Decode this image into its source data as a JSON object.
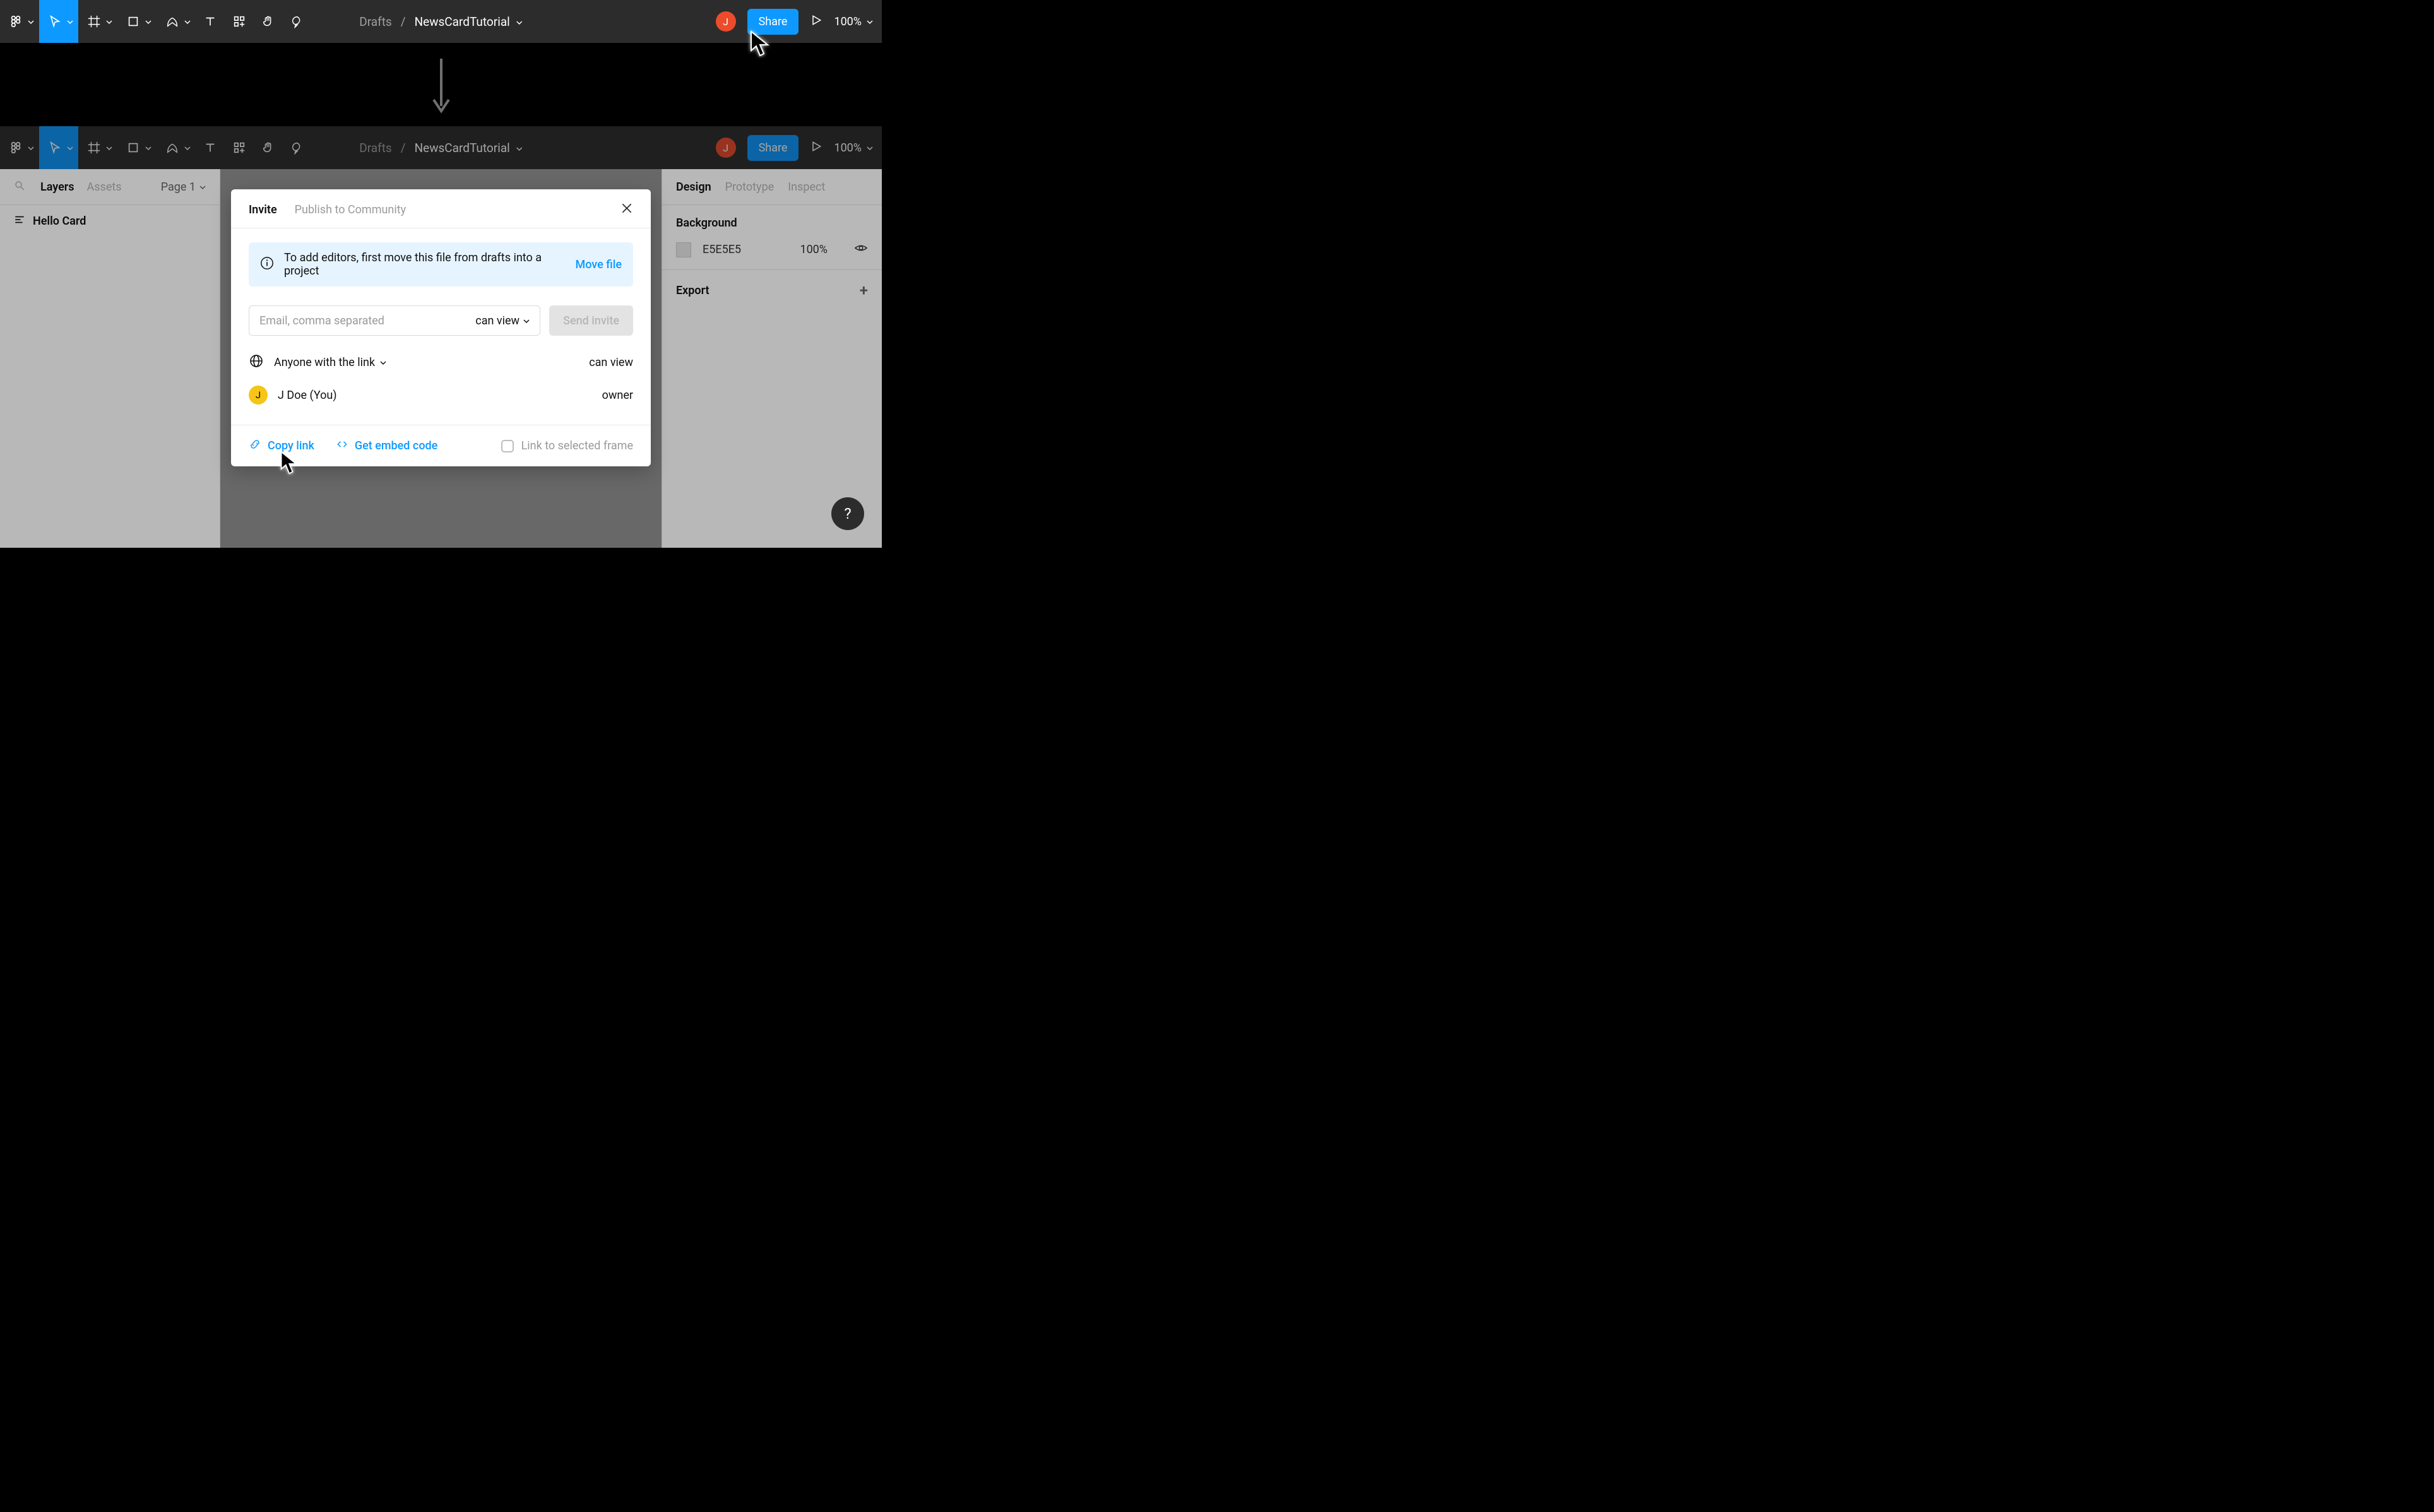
{
  "breadcrumb": {
    "folder": "Drafts",
    "file": "NewsCardTutorial"
  },
  "avatar_initial": "J",
  "share_button": "Share",
  "zoom": "100%",
  "left_panel": {
    "tabs": {
      "layers": "Layers",
      "assets": "Assets"
    },
    "page_selector": "Page 1",
    "layer_name": "Hello Card"
  },
  "right_panel": {
    "tabs": {
      "design": "Design",
      "prototype": "Prototype",
      "inspect": "Inspect"
    },
    "background": {
      "title": "Background",
      "hex": "E5E5E5",
      "opacity": "100%"
    },
    "export_title": "Export"
  },
  "modal": {
    "tabs": {
      "invite": "Invite",
      "publish": "Publish to Community"
    },
    "banner_msg": "To add editors, first move this file from drafts into a project",
    "banner_action": "Move file",
    "email_placeholder": "Email, comma separated",
    "email_perm": "can view",
    "send_btn": "Send invite",
    "link_scope": "Anyone with the link",
    "link_perm": "can view",
    "owner_name": "J Doe (You)",
    "owner_role": "owner",
    "copy_link": "Copy link",
    "embed_code": "Get embed code",
    "frame_label": "Link to selected frame"
  },
  "help": "?"
}
